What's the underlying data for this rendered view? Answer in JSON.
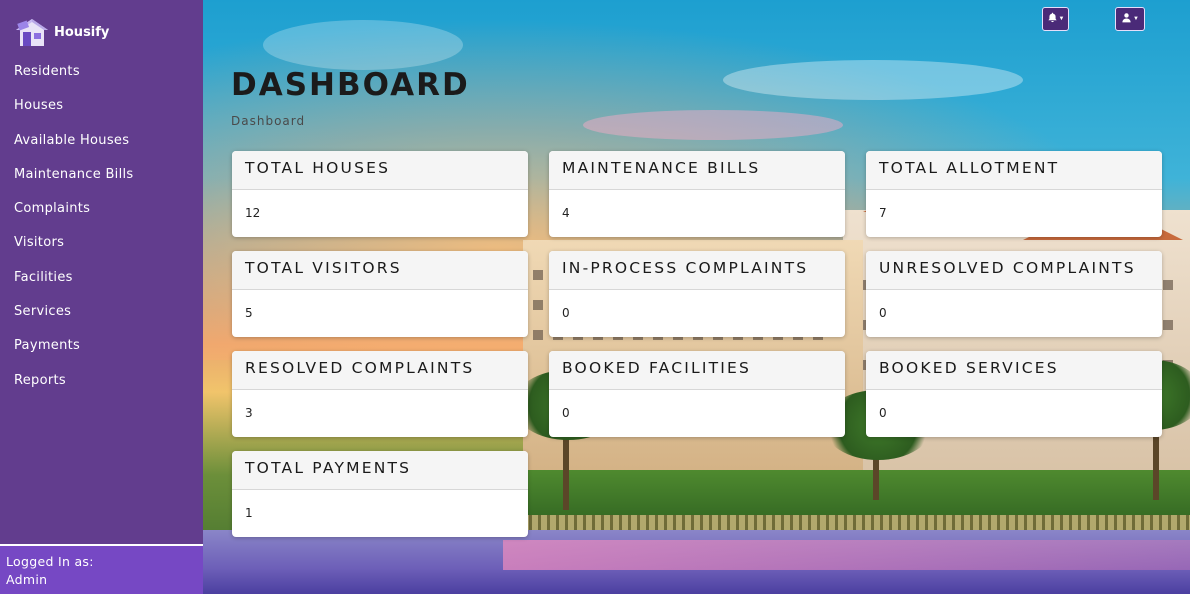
{
  "brand": {
    "name": "Housify",
    "logo_icon": "house-logo-icon"
  },
  "sidebar": {
    "items": [
      {
        "label": "Residents"
      },
      {
        "label": "Houses"
      },
      {
        "label": "Available Houses"
      },
      {
        "label": "Maintenance Bills"
      },
      {
        "label": "Complaints"
      },
      {
        "label": "Visitors"
      },
      {
        "label": "Facilities"
      },
      {
        "label": "Services"
      },
      {
        "label": "Payments"
      },
      {
        "label": "Reports"
      }
    ],
    "footer": {
      "logged_in_label": "Logged In as:",
      "user": "Admin"
    }
  },
  "header": {
    "notifications_icon": "bell-icon",
    "user_icon": "user-icon"
  },
  "page": {
    "title": "DASHBOARD",
    "breadcrumb": "Dashboard"
  },
  "cards": [
    {
      "title": "TOTAL HOUSES",
      "value": "12"
    },
    {
      "title": "MAINTENANCE BILLS",
      "value": "4"
    },
    {
      "title": "TOTAL ALLOTMENT",
      "value": "7"
    },
    {
      "title": "TOTAL VISITORS",
      "value": "5"
    },
    {
      "title": "IN-PROCESS COMPLAINTS",
      "value": "0"
    },
    {
      "title": "UNRESOLVED COMPLAINTS",
      "value": "0"
    },
    {
      "title": "RESOLVED COMPLAINTS",
      "value": "3"
    },
    {
      "title": "BOOKED FACILITIES",
      "value": "0"
    },
    {
      "title": "BOOKED SERVICES",
      "value": "0"
    },
    {
      "title": "TOTAL PAYMENTS",
      "value": "1"
    }
  ],
  "colors": {
    "sidebar": "#623d8e",
    "sidebar_footer": "#7648c4",
    "icon_button": "#4a2a78"
  }
}
